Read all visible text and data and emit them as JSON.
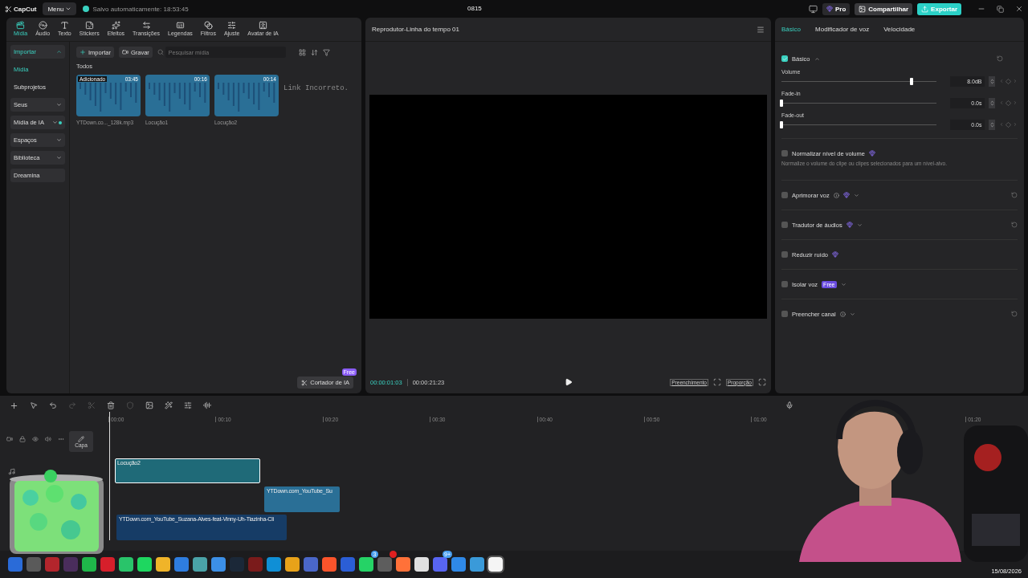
{
  "titlebar": {
    "logo": "CapCut",
    "menu": "Menu",
    "autosave": "Salvo automaticamente: 18:53:45",
    "project": "0815",
    "pro": "Pro",
    "share": "Compartilhar",
    "export": "Exportar"
  },
  "toolbar": [
    {
      "label": "Mídia",
      "selected": true
    },
    {
      "label": "Áudio",
      "selected": false
    },
    {
      "label": "Texto",
      "selected": false
    },
    {
      "label": "Stickers",
      "selected": false
    },
    {
      "label": "Efeitos",
      "selected": false
    },
    {
      "label": "Transições",
      "selected": false
    },
    {
      "label": "Legendas",
      "selected": false
    },
    {
      "label": "Filtros",
      "selected": false
    },
    {
      "label": "Ajuste",
      "selected": false
    },
    {
      "label": "Avatar de IA",
      "selected": false
    }
  ],
  "sidebar": [
    {
      "label": "Importar",
      "kind": "group",
      "selected": true,
      "expanded": true
    },
    {
      "label": "Mídia",
      "kind": "sub",
      "selected": true
    },
    {
      "label": "Subprojetos",
      "kind": "sub",
      "selected": false
    },
    {
      "label": "Seus",
      "kind": "group",
      "selected": false,
      "expanded": false
    },
    {
      "label": "Mídia de IA",
      "kind": "group",
      "selected": false,
      "expanded": false,
      "dot": true
    },
    {
      "label": "Espaços",
      "kind": "group",
      "selected": false,
      "expanded": false
    },
    {
      "label": "Biblioteca",
      "kind": "group",
      "selected": false,
      "expanded": false
    },
    {
      "label": "Dreamina",
      "kind": "item",
      "selected": false
    }
  ],
  "media": {
    "import": "Importar",
    "record": "Gravar",
    "search_placeholder": "Pesquisar mídia",
    "section": "Todos",
    "items": [
      {
        "name": "YTDown.co..._128k.mp3",
        "duration": "03:45",
        "badge": "Adicionado"
      },
      {
        "name": "Locução1",
        "duration": "00:16"
      },
      {
        "name": "Locução2",
        "duration": "00:14"
      }
    ],
    "overlay_text": "Link Incorreto.",
    "ai_cutter": "Cortador de IA",
    "ai_cutter_badge": "Free"
  },
  "player": {
    "title": "Reprodutor-Linha do tempo 01",
    "current": "00:00:01:03",
    "total": "00:00:21:23",
    "fill": "Preenchimento",
    "ratio": "Proporção"
  },
  "inspector": {
    "tabs": [
      {
        "label": "Básico",
        "selected": true
      },
      {
        "label": "Modificador de voz",
        "selected": false
      },
      {
        "label": "Velocidade",
        "selected": false
      }
    ],
    "section": {
      "label": "Básico",
      "checked": true,
      "expanded": true
    },
    "sliders": [
      {
        "label": "Volume",
        "level": 0.84,
        "value": "8.0dB"
      },
      {
        "label": "Fade-in",
        "level": 0,
        "value": "0.0s"
      },
      {
        "label": "Fade-out",
        "level": 0,
        "value": "0.0s"
      }
    ],
    "options": [
      {
        "label": "Normalizar nível de volume",
        "checked": false,
        "pro": true,
        "info": false,
        "dropdown": false,
        "reset": false,
        "description": "Normalize o volume do clipe ou clipes selecionados para um nível-alvo."
      },
      {
        "label": "Aprimorar voz",
        "checked": false,
        "pro": true,
        "info": true,
        "dropdown": true,
        "reset": true
      },
      {
        "label": "Tradutor de áudios",
        "checked": false,
        "pro": true,
        "info": false,
        "dropdown": true,
        "reset": true
      },
      {
        "label": "Reduzir ruído",
        "checked": false,
        "pro": true,
        "info": false,
        "dropdown": false,
        "reset": false
      },
      {
        "label": "Isolar voz",
        "checked": false,
        "pro": false,
        "badge": "Free",
        "info": false,
        "dropdown": true,
        "reset": false
      },
      {
        "label": "Preencher canal",
        "checked": false,
        "pro": false,
        "info": true,
        "dropdown": true,
        "reset": true
      }
    ]
  },
  "timeline": {
    "ticks": [
      "00:00",
      "00:10",
      "00:20",
      "00:30",
      "00:40",
      "00:50",
      "01:00",
      "01:20"
    ],
    "cover": "Capa",
    "clips": [
      {
        "name": "Locução2",
        "selected": true
      },
      {
        "name": "YTDown.com_YouTube_Su",
        "selected": false
      },
      {
        "name": "YTDown.com_YouTube_Suzana-Alves-feat-Vinny-Uh-Tiazinha-Cli",
        "selected": false
      }
    ]
  },
  "taskbar": {
    "apps": [
      {
        "color": "#2a6bd8"
      },
      {
        "color": "#5a5a5a"
      },
      {
        "color": "#b3252c"
      },
      {
        "color": "#4a2d5c"
      },
      {
        "color": "#1fb84a"
      },
      {
        "color": "#d61f2b"
      },
      {
        "color": "#29c46a"
      },
      {
        "color": "#1ed760"
      },
      {
        "color": "#f0b429"
      },
      {
        "color": "#2e7de0"
      },
      {
        "color": "#4aa3a8"
      },
      {
        "color": "#3c8fe6"
      },
      {
        "color": "#1b2838"
      },
      {
        "color": "#7a1b1b"
      },
      {
        "color": "#0f8fd6"
      },
      {
        "color": "#e8a219"
      },
      {
        "color": "#4a67c9"
      },
      {
        "color": "#fb542b"
      },
      {
        "color": "#2b5ed6"
      },
      {
        "color": "#25d366",
        "badge": "3"
      },
      {
        "color": "#5d5d5d",
        "alert": true
      },
      {
        "color": "#ff7139"
      },
      {
        "color": "#e0e0e0"
      },
      {
        "color": "#5865f2",
        "badge": "9+"
      },
      {
        "color": "#2f89e8"
      },
      {
        "color": "#3a9ad9"
      },
      {
        "color": "#f5f5f5",
        "selected": true
      }
    ],
    "date": "15/08/2026"
  }
}
